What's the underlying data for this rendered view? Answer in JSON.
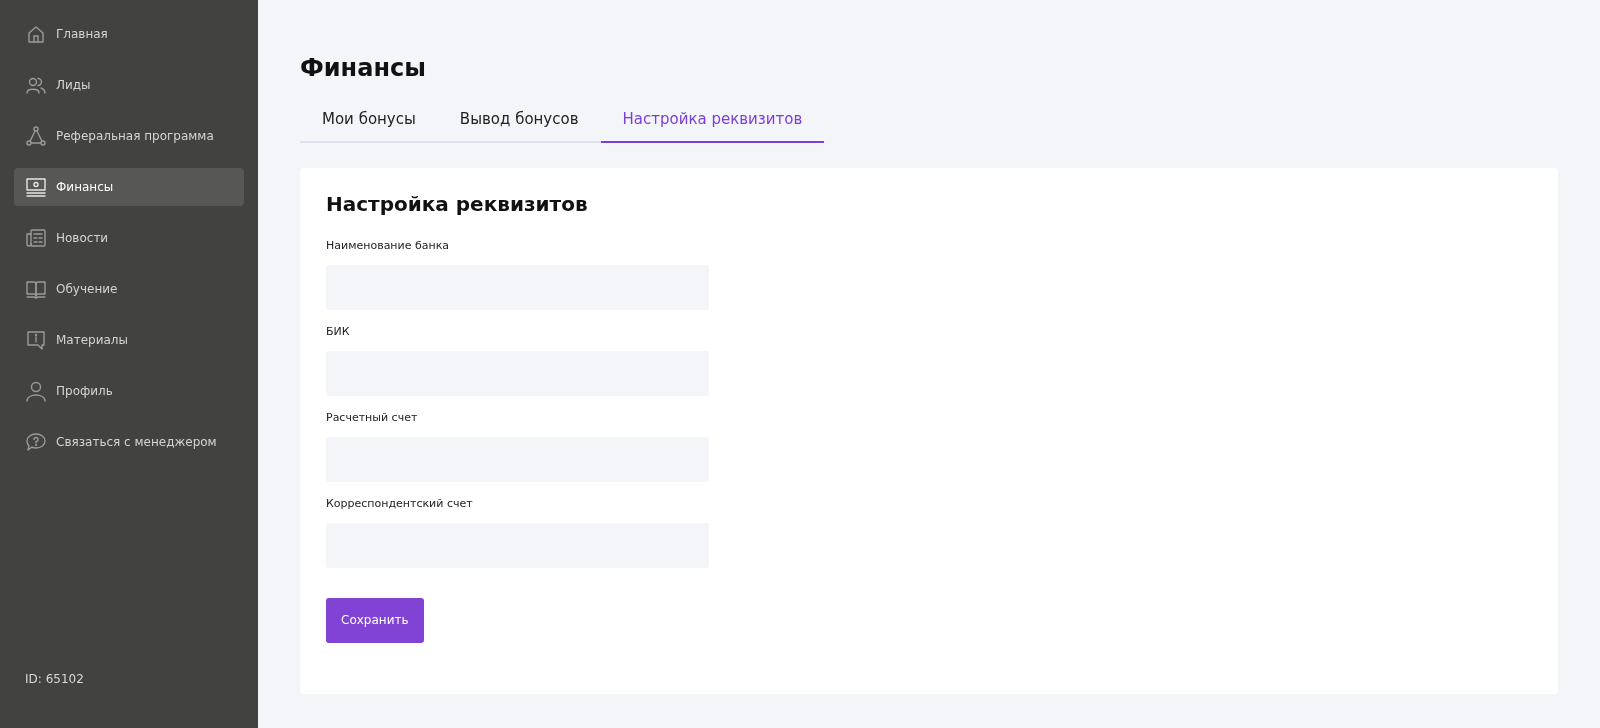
{
  "sidebar": {
    "items": [
      {
        "label": "Главная",
        "selected": false
      },
      {
        "label": "Лиды",
        "selected": false
      },
      {
        "label": "Реферальная программа",
        "selected": false
      },
      {
        "label": "Финансы",
        "selected": true
      },
      {
        "label": "Новости",
        "selected": false
      },
      {
        "label": "Обучение",
        "selected": false
      },
      {
        "label": "Материалы",
        "selected": false
      },
      {
        "label": "Профиль",
        "selected": false
      },
      {
        "label": "Связаться с менеджером",
        "selected": false
      }
    ],
    "user_id": "ID: 65102"
  },
  "page_title": "Финансы",
  "tabs": [
    {
      "label": "Мои бонусы",
      "selected": false
    },
    {
      "label": "Вывод бонусов",
      "selected": false
    },
    {
      "label": "Настройка реквизитов",
      "selected": true
    }
  ],
  "form": {
    "title": "Настройка реквизитов",
    "fields": [
      {
        "label": "Наименование банка"
      },
      {
        "label": "БИК"
      },
      {
        "label": "Расчетный счет"
      },
      {
        "label": "Корреспондентский счет"
      }
    ],
    "button": "Сохранить"
  }
}
